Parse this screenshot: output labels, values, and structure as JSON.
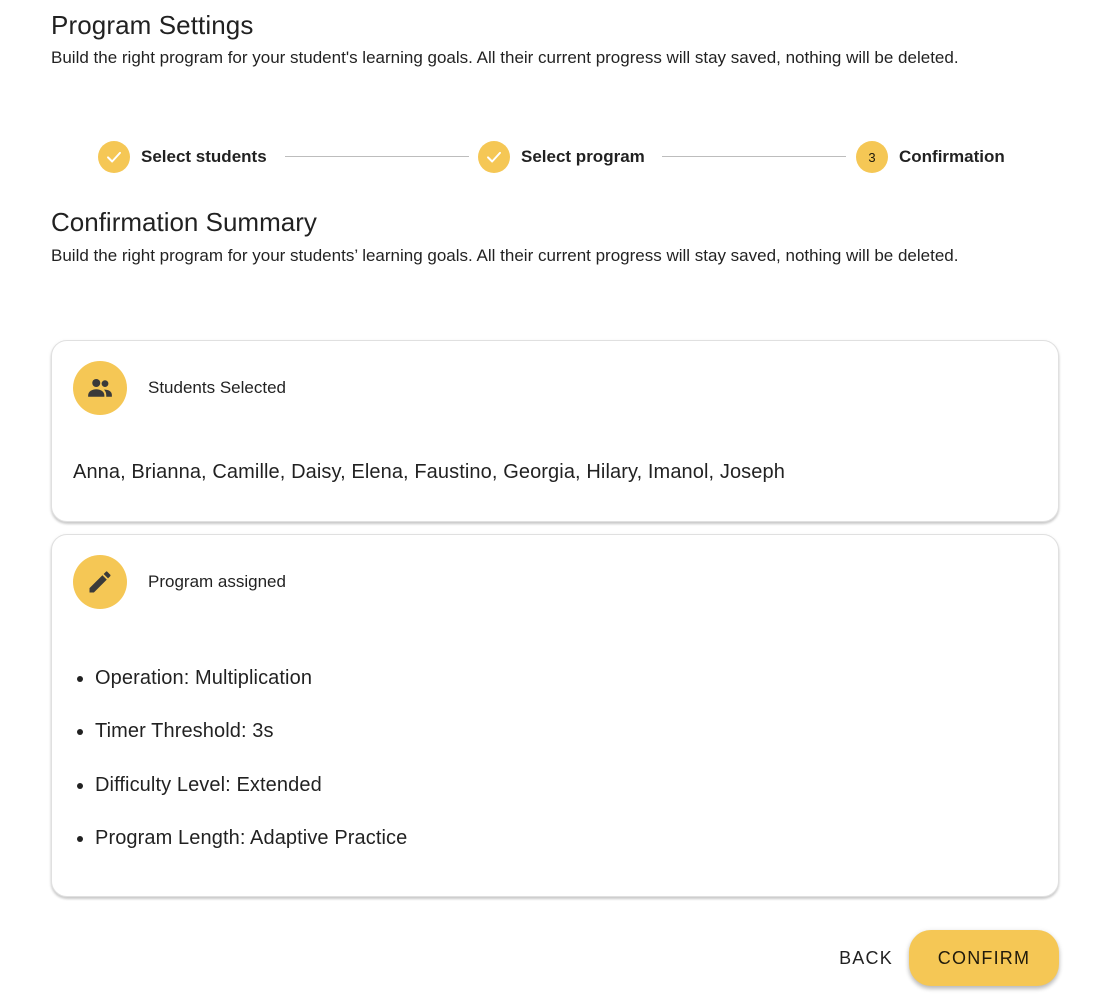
{
  "header": {
    "title": "Program Settings",
    "description": "Build the right program for your student's learning goals. All their current progress will stay saved, nothing will be deleted."
  },
  "stepper": {
    "accent_color": "#f5c755",
    "steps": [
      {
        "label": "Select students",
        "state": "completed",
        "icon": "check-icon"
      },
      {
        "label": "Select program",
        "state": "completed",
        "icon": "check-icon"
      },
      {
        "label": "Confirmation",
        "state": "active",
        "number": "3"
      }
    ]
  },
  "summary": {
    "title": "Confirmation Summary",
    "description": "Build the right program for your students’ learning goals. All their current progress will stay saved, nothing will be deleted."
  },
  "students_card": {
    "icon": "people-icon",
    "title": "Students Selected",
    "students": "Anna, Brianna, Camille, Daisy, Elena, Faustino, Georgia, Hilary, Imanol, Joseph"
  },
  "program_card": {
    "icon": "pencil-icon",
    "title": "Program assigned",
    "items": [
      "Operation: Multiplication",
      "Timer Threshold: 3s",
      "Difficulty Level: Extended",
      "Program Length: Adaptive Practice"
    ]
  },
  "actions": {
    "back_label": "BACK",
    "confirm_label": "CONFIRM"
  }
}
